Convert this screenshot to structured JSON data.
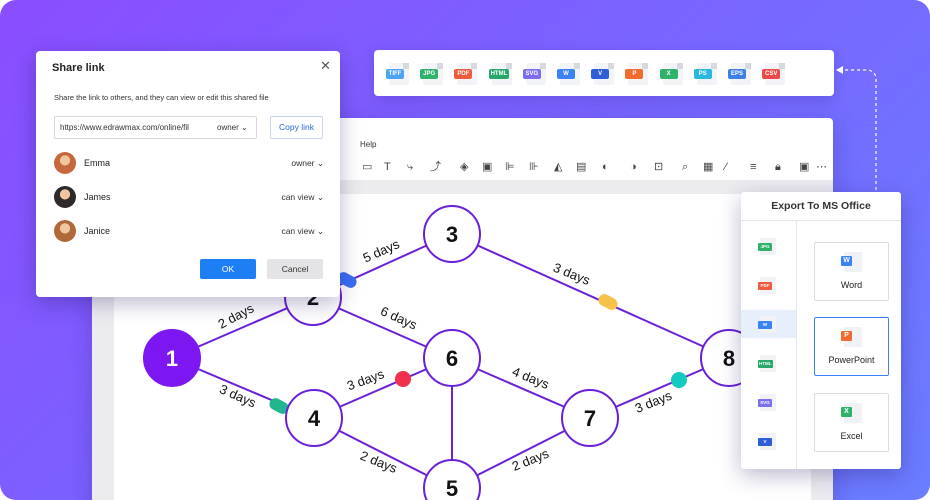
{
  "editor": {
    "menu_help": "Help",
    "toolbar_icons": [
      "rectangle-icon",
      "text-icon",
      "connector-icon",
      "pointer-icon",
      "layers-icon",
      "group-icon",
      "align-icon",
      "distribute-icon",
      "flip-icon",
      "image-icon",
      "fill-icon",
      "shape-style-icon",
      "crop-icon",
      "search-icon",
      "find-replace-icon",
      "pen-icon",
      "line-style-icon",
      "lock-icon",
      "fit-icon",
      "more-icon"
    ]
  },
  "format_strip": {
    "formats": [
      {
        "label": "TIFF",
        "color": "#4ea3f2"
      },
      {
        "label": "JPG",
        "color": "#2fb36a"
      },
      {
        "label": "PDF",
        "color": "#ef5b3c"
      },
      {
        "label": "HTML",
        "color": "#27a86a"
      },
      {
        "label": "SVG",
        "color": "#7b6ef0"
      },
      {
        "label": "W",
        "color": "#3b82f6"
      },
      {
        "label": "V",
        "color": "#2f5fd6"
      },
      {
        "label": "P",
        "color": "#f26b2f"
      },
      {
        "label": "X",
        "color": "#2fb36a"
      },
      {
        "label": "PS",
        "color": "#28b8e0"
      },
      {
        "label": "EPS",
        "color": "#3d7fe6"
      },
      {
        "label": "CSV",
        "color": "#ef4a4a"
      }
    ]
  },
  "share": {
    "title": "Share link",
    "description": "Share the link to others, and they can view or edit this shared file",
    "url": "https://www.edrawmax.com/online/fil",
    "url_permission": "owner",
    "copy_label": "Copy link",
    "users": [
      {
        "name": "Emma",
        "role": "owner",
        "avatar": "#c7673d"
      },
      {
        "name": "James",
        "role": "can view",
        "avatar": "#2e2a2a"
      },
      {
        "name": "Janice",
        "role": "can view",
        "avatar": "#b06a3a"
      }
    ],
    "ok_label": "OK",
    "cancel_label": "Cancel"
  },
  "export": {
    "title": "Export To MS Office",
    "side_formats": [
      {
        "label": "JPG",
        "color": "#2fb36a"
      },
      {
        "label": "PDF",
        "color": "#ef5b3c"
      },
      {
        "label": "W",
        "color": "#3b82f6"
      },
      {
        "label": "HTML",
        "color": "#27a86a"
      },
      {
        "label": "SVG",
        "color": "#7b6ef0"
      },
      {
        "label": "V",
        "color": "#2f5fd6"
      }
    ],
    "cards": [
      {
        "label": "Word",
        "tag": "W",
        "color": "#3b82f6"
      },
      {
        "label": "PowerPoint",
        "tag": "P",
        "color": "#f26b2f"
      },
      {
        "label": "Excel",
        "tag": "X",
        "color": "#2fb36a"
      }
    ]
  },
  "diagram": {
    "nodes": [
      "1",
      "2",
      "3",
      "4",
      "5",
      "6",
      "7",
      "8"
    ],
    "edge_labels": [
      "2 days",
      "5 days",
      "3 days",
      "3 days",
      "6 days",
      "3 days",
      "4 days",
      "2 days",
      "2 days",
      "3 days"
    ],
    "colors": {
      "line": "#6a1fd8",
      "node_fill": "#7c17f2",
      "marker_blue": "#3b6ef5",
      "marker_yellow": "#f5c24a",
      "marker_green": "#1fb58e",
      "marker_red": "#f0304d",
      "marker_cyan": "#14c9c0"
    }
  }
}
